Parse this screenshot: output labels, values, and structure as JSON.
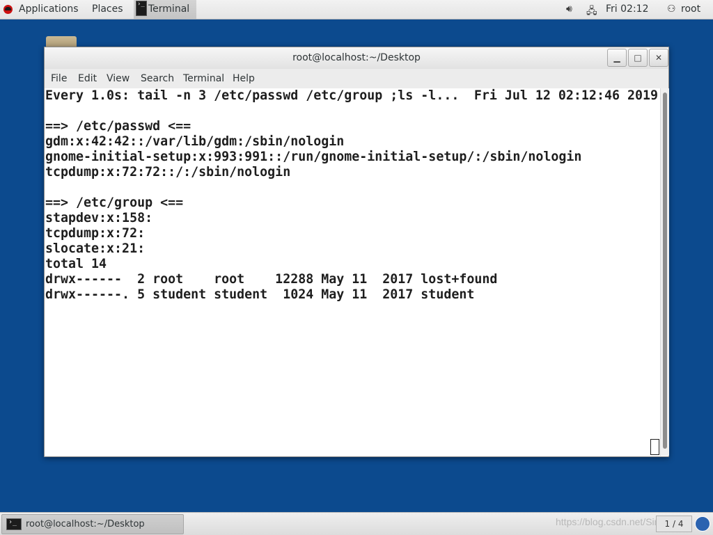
{
  "top_panel": {
    "applications": "Applications",
    "places": "Places",
    "task": "Terminal",
    "clock": "Fri 02:12",
    "user": "root"
  },
  "window": {
    "title": "root@localhost:~/Desktop",
    "menus": [
      "File",
      "Edit",
      "View",
      "Search",
      "Terminal",
      "Help"
    ]
  },
  "terminal": {
    "header_left": "Every 1.0s: tail -n 3 /etc/passwd /etc/group ;ls -l...",
    "header_right": "Fri Jul 12 02:12:46 2019",
    "lines": [
      "",
      "==> /etc/passwd <==",
      "gdm:x:42:42::/var/lib/gdm:/sbin/nologin",
      "gnome-initial-setup:x:993:991::/run/gnome-initial-setup/:/sbin/nologin",
      "tcpdump:x:72:72::/:/sbin/nologin",
      "",
      "==> /etc/group <==",
      "stapdev:x:158:",
      "tcpdump:x:72:",
      "slocate:x:21:",
      "total 14",
      "drwx------  2 root    root    12288 May 11  2017 lost+found",
      "drwx------. 5 student student  1024 May 11  2017 student"
    ]
  },
  "taskbar": {
    "window_label": "root@localhost:~/Desktop",
    "workspace": "1 / 4",
    "watermark": "https://blog.csdn.net/Simaelli"
  }
}
